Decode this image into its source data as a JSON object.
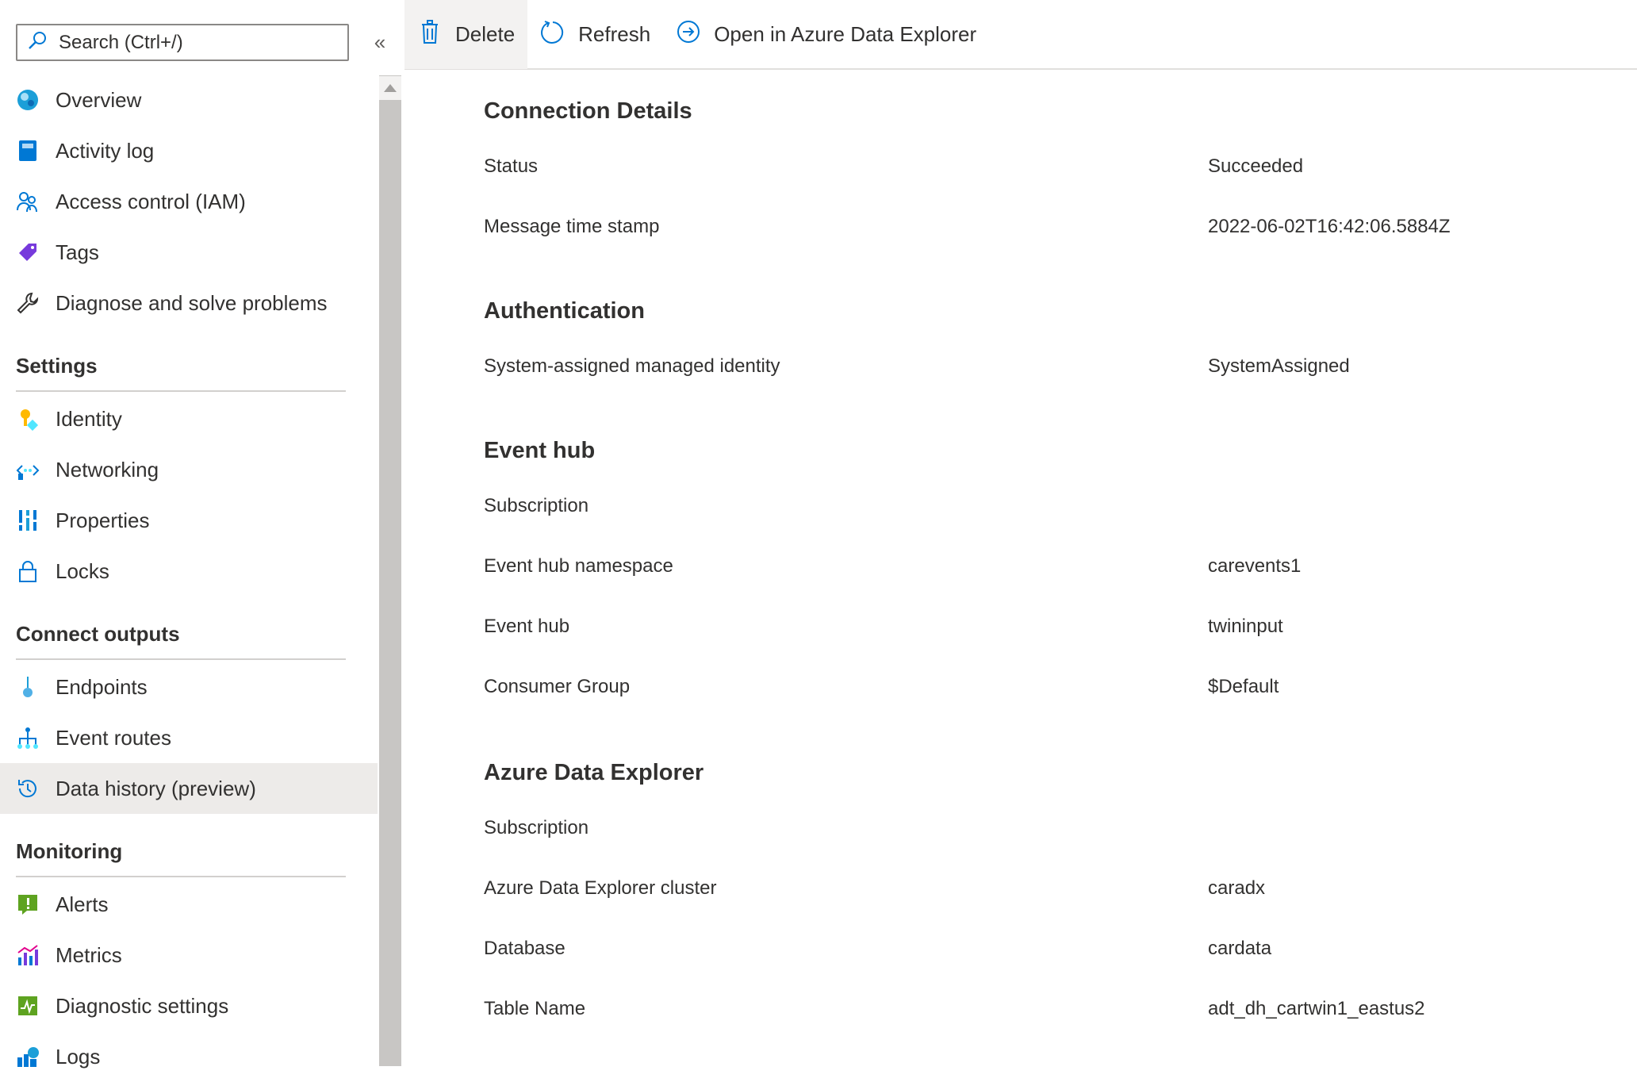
{
  "search": {
    "placeholder": "Search (Ctrl+/)"
  },
  "collapse_glyph": "«",
  "nav": {
    "top_items": [
      {
        "label": "Overview",
        "icon": "overview-icon"
      },
      {
        "label": "Activity log",
        "icon": "activity-log-icon"
      },
      {
        "label": "Access control (IAM)",
        "icon": "iam-icon"
      },
      {
        "label": "Tags",
        "icon": "tag-icon"
      },
      {
        "label": "Diagnose and solve problems",
        "icon": "wrench-icon"
      }
    ],
    "settings": {
      "title": "Settings",
      "items": [
        {
          "label": "Identity",
          "icon": "identity-icon"
        },
        {
          "label": "Networking",
          "icon": "networking-icon"
        },
        {
          "label": "Properties",
          "icon": "properties-icon"
        },
        {
          "label": "Locks",
          "icon": "lock-icon"
        }
      ]
    },
    "connect_outputs": {
      "title": "Connect outputs",
      "items": [
        {
          "label": "Endpoints",
          "icon": "endpoint-icon"
        },
        {
          "label": "Event routes",
          "icon": "event-routes-icon"
        },
        {
          "label": "Data history (preview)",
          "icon": "history-icon",
          "selected": true
        }
      ]
    },
    "monitoring": {
      "title": "Monitoring",
      "items": [
        {
          "label": "Alerts",
          "icon": "alert-icon"
        },
        {
          "label": "Metrics",
          "icon": "metrics-icon"
        },
        {
          "label": "Diagnostic settings",
          "icon": "diagnostic-settings-icon"
        },
        {
          "label": "Logs",
          "icon": "logs-icon"
        }
      ]
    }
  },
  "toolbar": {
    "delete_label": "Delete",
    "refresh_label": "Refresh",
    "open_adx_label": "Open in Azure Data Explorer"
  },
  "details": {
    "connection": {
      "title": "Connection Details",
      "status_label": "Status",
      "status_value": "Succeeded",
      "timestamp_label": "Message time stamp",
      "timestamp_value": "2022-06-02T16:42:06.5884Z"
    },
    "authentication": {
      "title": "Authentication",
      "identity_label": "System-assigned managed identity",
      "identity_value": "SystemAssigned"
    },
    "event_hub": {
      "title": "Event hub",
      "subscription_label": "Subscription",
      "subscription_value": "",
      "namespace_label": "Event hub namespace",
      "namespace_value": "carevents1",
      "hub_label": "Event hub",
      "hub_value": "twininput",
      "consumer_label": "Consumer Group",
      "consumer_value": "$Default"
    },
    "adx": {
      "title": "Azure Data Explorer",
      "subscription_label": "Subscription",
      "subscription_value": "",
      "cluster_label": "Azure Data Explorer cluster",
      "cluster_value": "caradx",
      "database_label": "Database",
      "database_value": "cardata",
      "table_label": "Table Name",
      "table_value": "adt_dh_cartwin1_eastus2"
    }
  },
  "colors": {
    "azure_blue": "#0078d4",
    "selected_bg": "#edebe9",
    "text": "#323130"
  }
}
